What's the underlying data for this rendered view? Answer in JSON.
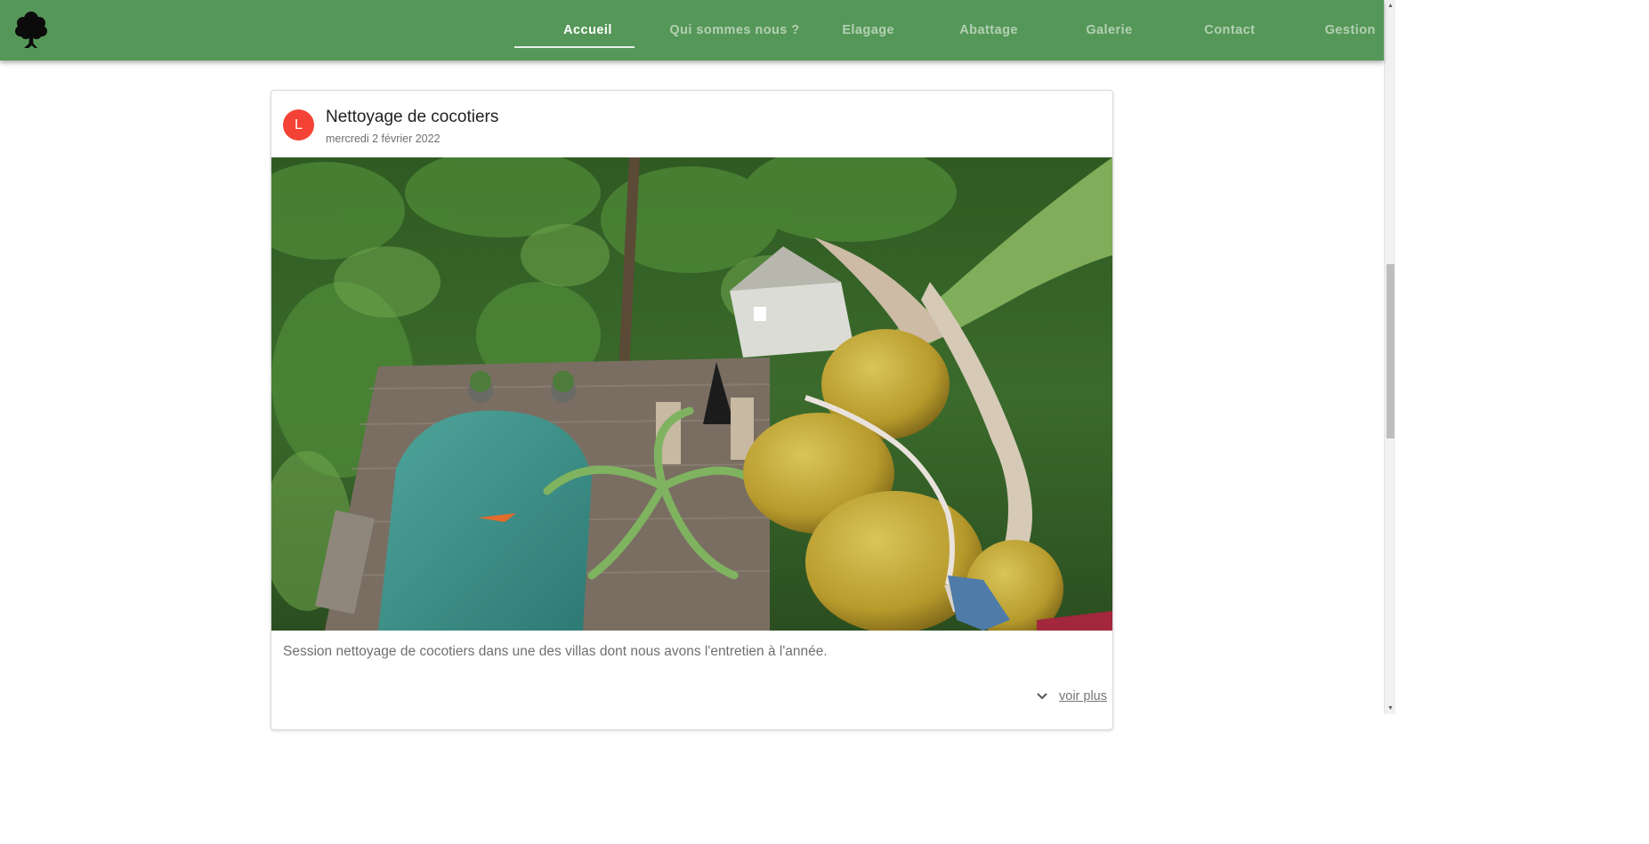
{
  "header": {
    "logo_icon": "tree-icon",
    "background": "#559758",
    "nav": [
      {
        "label": "Accueil",
        "active": true
      },
      {
        "label": "Qui sommes nous ?",
        "active": false
      },
      {
        "label": "Elagage",
        "active": false
      },
      {
        "label": "Abattage",
        "active": false
      },
      {
        "label": "Galerie",
        "active": false
      },
      {
        "label": "Contact",
        "active": false
      },
      {
        "label": "Gestion",
        "active": false
      }
    ]
  },
  "post": {
    "avatar_letter": "L",
    "avatar_color": "#f44336",
    "title": "Nettoyage de cocotiers",
    "date": "mercredi 2 février 2022",
    "image_icon": "coconut-tree-photo",
    "description": "Session nettoyage de cocotiers dans une des villas dont nous avons l'entretien à l'année.",
    "expand_icon": "chevron-down-icon",
    "more_label": "voir plus"
  }
}
